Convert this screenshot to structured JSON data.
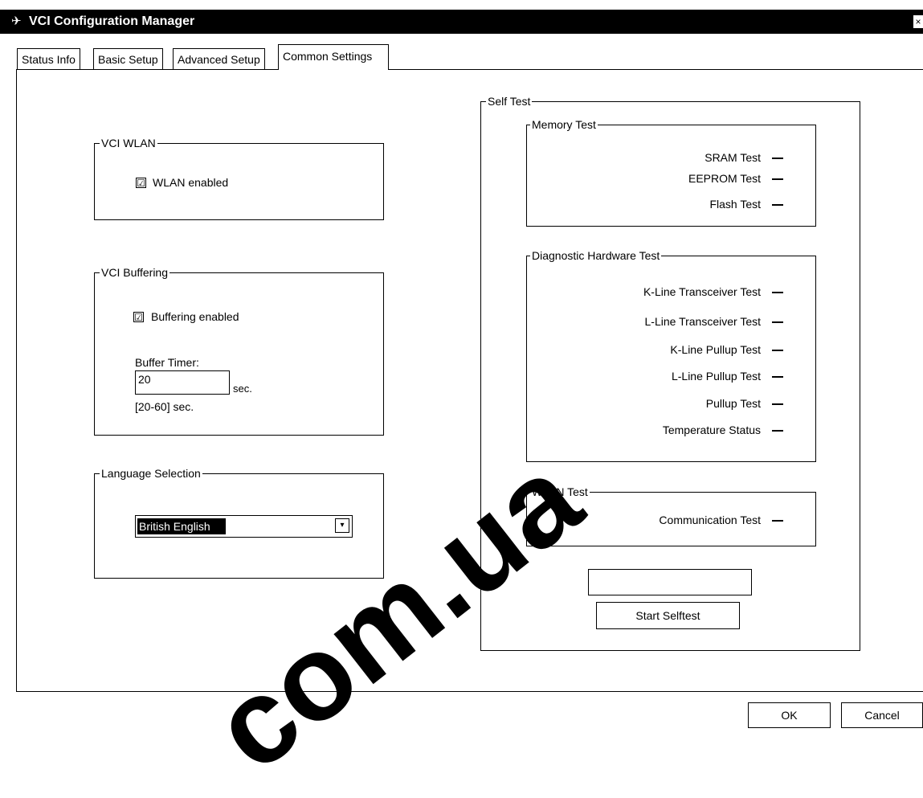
{
  "window": {
    "title": "VCI Configuration Manager",
    "close_glyph": "×"
  },
  "tabs": [
    {
      "label": "Status Info"
    },
    {
      "label": "Basic Setup"
    },
    {
      "label": "Advanced Setup"
    },
    {
      "label": "Common Settings",
      "active": true
    }
  ],
  "wlan_group": {
    "legend": "VCI WLAN",
    "checkbox_label": "WLAN enabled",
    "checked": true
  },
  "buffering_group": {
    "legend": "VCI Buffering",
    "checkbox_label": "Buffering enabled",
    "checked": true,
    "timer_label": "Buffer Timer:",
    "timer_value": "20",
    "timer_unit": "sec.",
    "timer_range": "[20-60] sec."
  },
  "language_group": {
    "legend": "Language Selection",
    "selected": "British English"
  },
  "self_test": {
    "legend": "Self Test",
    "memory": {
      "legend": "Memory Test",
      "rows": [
        "SRAM Test",
        "EEPROM Test",
        "Flash Test"
      ]
    },
    "hardware": {
      "legend": "Diagnostic Hardware Test",
      "rows": [
        "K-Line Transceiver Test",
        "L-Line Transceiver Test",
        "K-Line Pullup Test",
        "L-Line Pullup Test",
        "Pullup Test",
        "Temperature Status"
      ]
    },
    "wlan": {
      "legend": "WLAN Test",
      "rows": [
        "Communication Test"
      ]
    },
    "status_value": "",
    "start_button": "Start Selftest"
  },
  "footer": {
    "ok": "OK",
    "cancel": "Cancel"
  },
  "watermark": {
    "text": "com.ua"
  },
  "checkmark": "☑",
  "arrow_glyph": "▾",
  "logo_glyph": "✈"
}
